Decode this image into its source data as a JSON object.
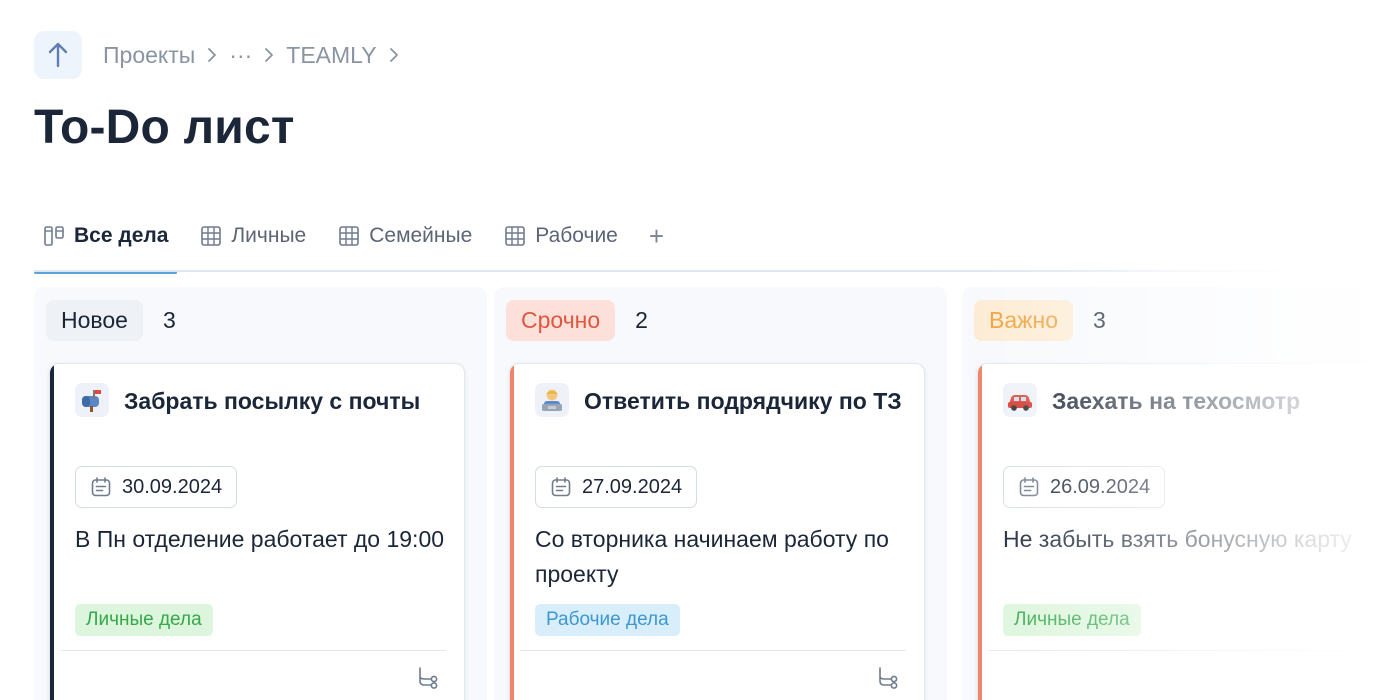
{
  "breadcrumb": {
    "items": [
      "Проекты",
      "···",
      "TEAMLY"
    ]
  },
  "page": {
    "title": "To-Do лист"
  },
  "tabs": [
    {
      "label": "Все дела",
      "icon": "board-icon",
      "active": true
    },
    {
      "label": "Личные",
      "icon": "table-icon",
      "active": false
    },
    {
      "label": "Семейные",
      "icon": "table-icon",
      "active": false
    },
    {
      "label": "Рабочие",
      "icon": "table-icon",
      "active": false
    }
  ],
  "add_tab_label": "+",
  "colors": {
    "accent": "#5aa3dd",
    "dark": "#1b2638",
    "urgent": "#ef8466",
    "important": "#f2a64a"
  },
  "columns": [
    {
      "name": "Новое",
      "count": "3",
      "card": {
        "icon": "mailbox-icon",
        "title": "Забрать посылку с почты",
        "date": "30.09.2024",
        "description": "В Пн отделение работает до 19:00",
        "tag": "Личные дела"
      }
    },
    {
      "name": "Срочно",
      "count": "2",
      "card": {
        "icon": "technologist-icon",
        "title": "Ответить подрядчику по ТЗ",
        "date": "27.09.2024",
        "description": "Со вторника начинаем работу по проекту",
        "tag": "Рабочие дела"
      }
    },
    {
      "name": "Важно",
      "count": "3",
      "card": {
        "icon": "car-icon",
        "title": "Заехать на техосмотр",
        "date": "26.09.2024",
        "description": "Не забыть взять бонусную карту",
        "tag": "Личные дела"
      }
    }
  ]
}
